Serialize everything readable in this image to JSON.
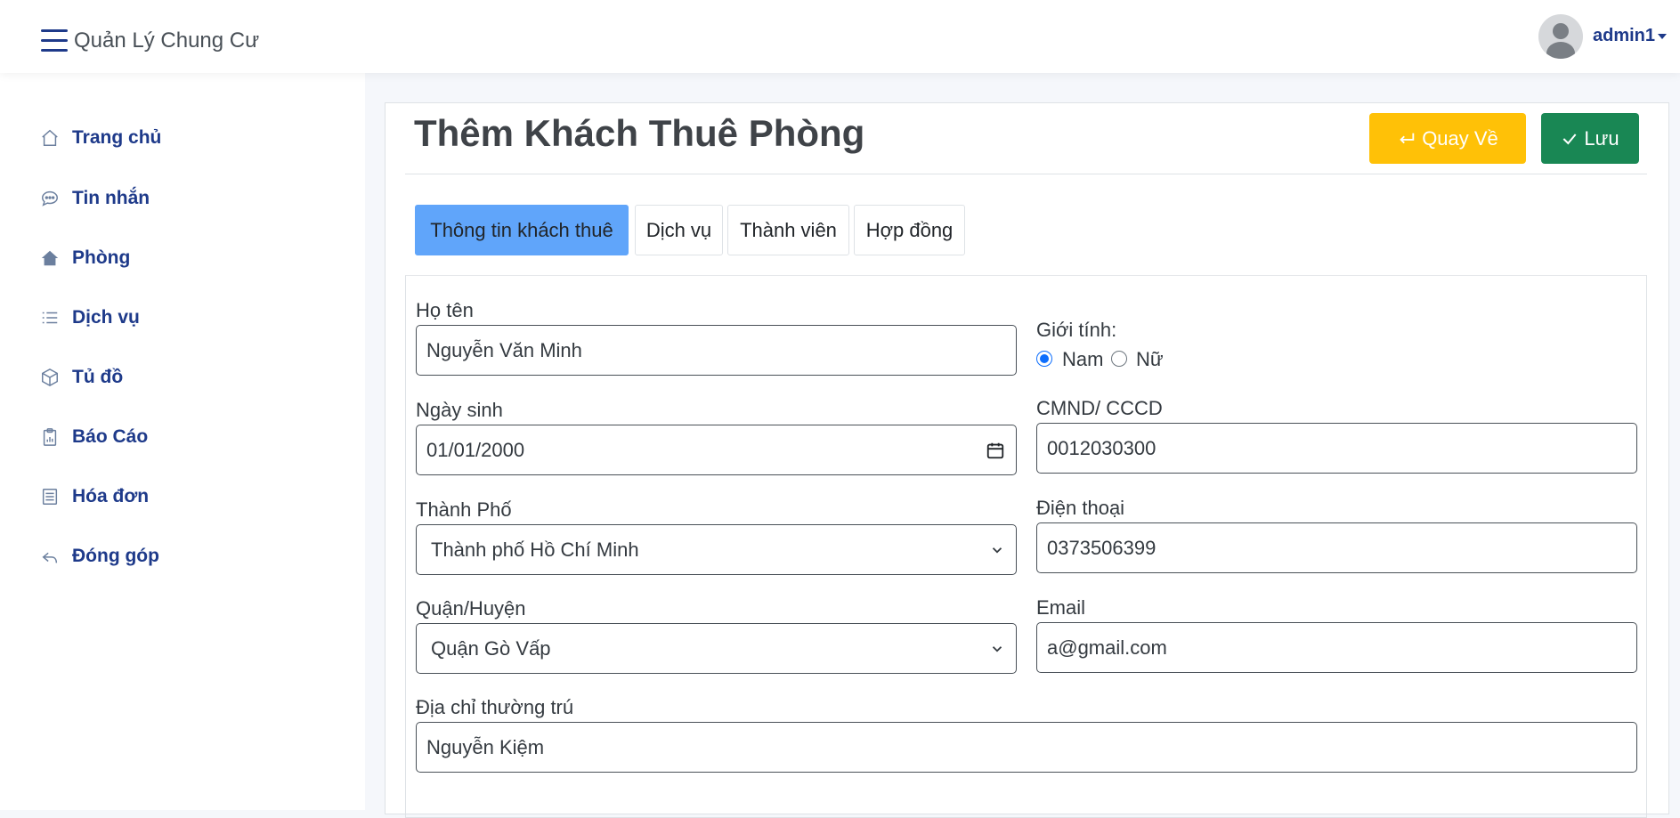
{
  "app": {
    "title": "Quản Lý Chung Cư"
  },
  "user": {
    "name": "admin1"
  },
  "sidebar": {
    "items": [
      {
        "label": "Trang chủ",
        "icon": "home-icon"
      },
      {
        "label": "Tin nhắn",
        "icon": "chat-icon"
      },
      {
        "label": "Phòng",
        "icon": "house-fill-icon"
      },
      {
        "label": "Dịch vụ",
        "icon": "list-icon"
      },
      {
        "label": "Tủ đồ",
        "icon": "box-icon"
      },
      {
        "label": "Báo Cáo",
        "icon": "clipboard-chart-icon"
      },
      {
        "label": "Hóa đơn",
        "icon": "receipt-icon"
      },
      {
        "label": "Đóng góp",
        "icon": "reply-icon"
      }
    ]
  },
  "page": {
    "title": "Thêm Khách Thuê Phòng",
    "back_label": "Quay Về",
    "save_label": "Lưu"
  },
  "tabs": [
    {
      "label": "Thông tin khách thuê",
      "active": true
    },
    {
      "label": "Dịch vụ",
      "active": false
    },
    {
      "label": "Thành viên",
      "active": false
    },
    {
      "label": "Hợp đồng",
      "active": false
    }
  ],
  "form": {
    "full_name": {
      "label": "Họ tên",
      "value": "Nguyễn Văn Minh"
    },
    "gender": {
      "label": "Giới tính:",
      "options": [
        "Nam",
        "Nữ"
      ],
      "selected": "Nam"
    },
    "birth_date": {
      "label": "Ngày sinh",
      "value": "01/01/2000"
    },
    "id_card": {
      "label": "CMND/ CCCD",
      "value": "0012030300"
    },
    "city": {
      "label": "Thành Phố",
      "value": "Thành phố Hồ Chí Minh"
    },
    "phone": {
      "label": "Điện thoại",
      "value": "0373506399"
    },
    "district": {
      "label": "Quận/Huyện",
      "value": "Quận Gò Vấp"
    },
    "email": {
      "label": "Email",
      "value": "a@gmail.com"
    },
    "address": {
      "label": "Địa chỉ thường trú",
      "value": "Nguyễn Kiệm"
    }
  },
  "colors": {
    "primary_text": "#1e3a8a",
    "back_button": "#ffc107",
    "save_button": "#198754",
    "active_tab": "#60a5fa"
  }
}
